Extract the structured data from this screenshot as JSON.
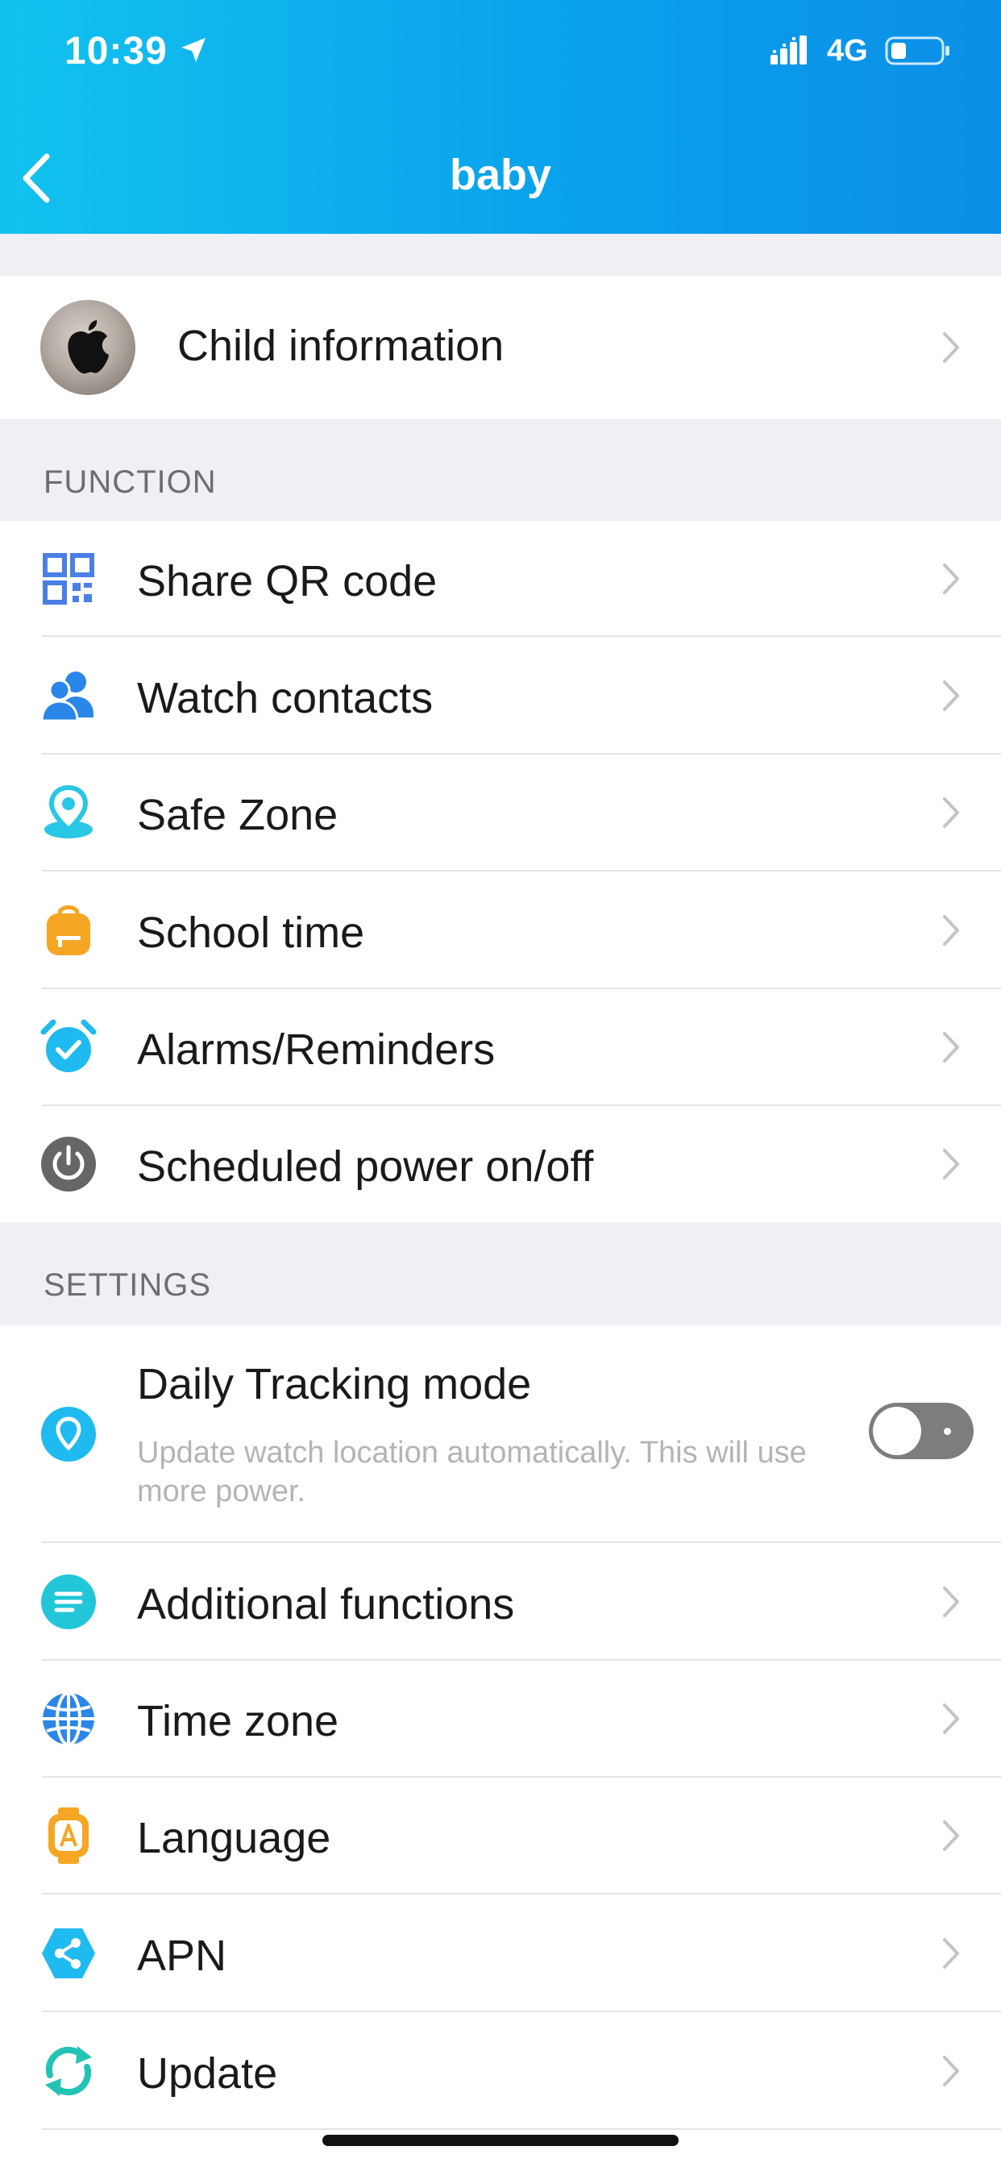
{
  "status_bar": {
    "time": "10:39",
    "network": "4G"
  },
  "header": {
    "title": "baby"
  },
  "child_row": {
    "label": "Child information"
  },
  "function_section": {
    "title": "FUNCTION",
    "items": [
      {
        "label": "Share QR code",
        "icon": "qr-code-icon",
        "color": "#4a7fe6"
      },
      {
        "label": "Watch contacts",
        "icon": "contacts-icon",
        "color": "#2a86e8"
      },
      {
        "label": "Safe Zone",
        "icon": "safe-zone-icon",
        "color": "#29c6e6"
      },
      {
        "label": "School time",
        "icon": "school-bag-icon",
        "color": "#f5a623"
      },
      {
        "label": "Alarms/Reminders",
        "icon": "alarm-clock-icon",
        "color": "#1fbaf0"
      },
      {
        "label": "Scheduled power on/off",
        "icon": "power-icon",
        "color": "#6b6b6b"
      }
    ]
  },
  "settings_section": {
    "title": "SETTINGS",
    "tracking": {
      "label": "Daily Tracking mode",
      "description": "Update watch location automatically. This will use more power.",
      "icon": "location-pin-icon",
      "enabled": false
    },
    "items": [
      {
        "label": "Additional functions",
        "icon": "list-icon",
        "color": "#21c7d8"
      },
      {
        "label": "Time zone",
        "icon": "globe-icon",
        "color": "#2a86e8"
      },
      {
        "label": "Language",
        "icon": "language-watch-icon",
        "color": "#f5a623"
      },
      {
        "label": "APN",
        "icon": "share-icon",
        "color": "#1fbaf0"
      },
      {
        "label": "Update",
        "icon": "refresh-icon",
        "color": "#22c3b5"
      }
    ]
  }
}
